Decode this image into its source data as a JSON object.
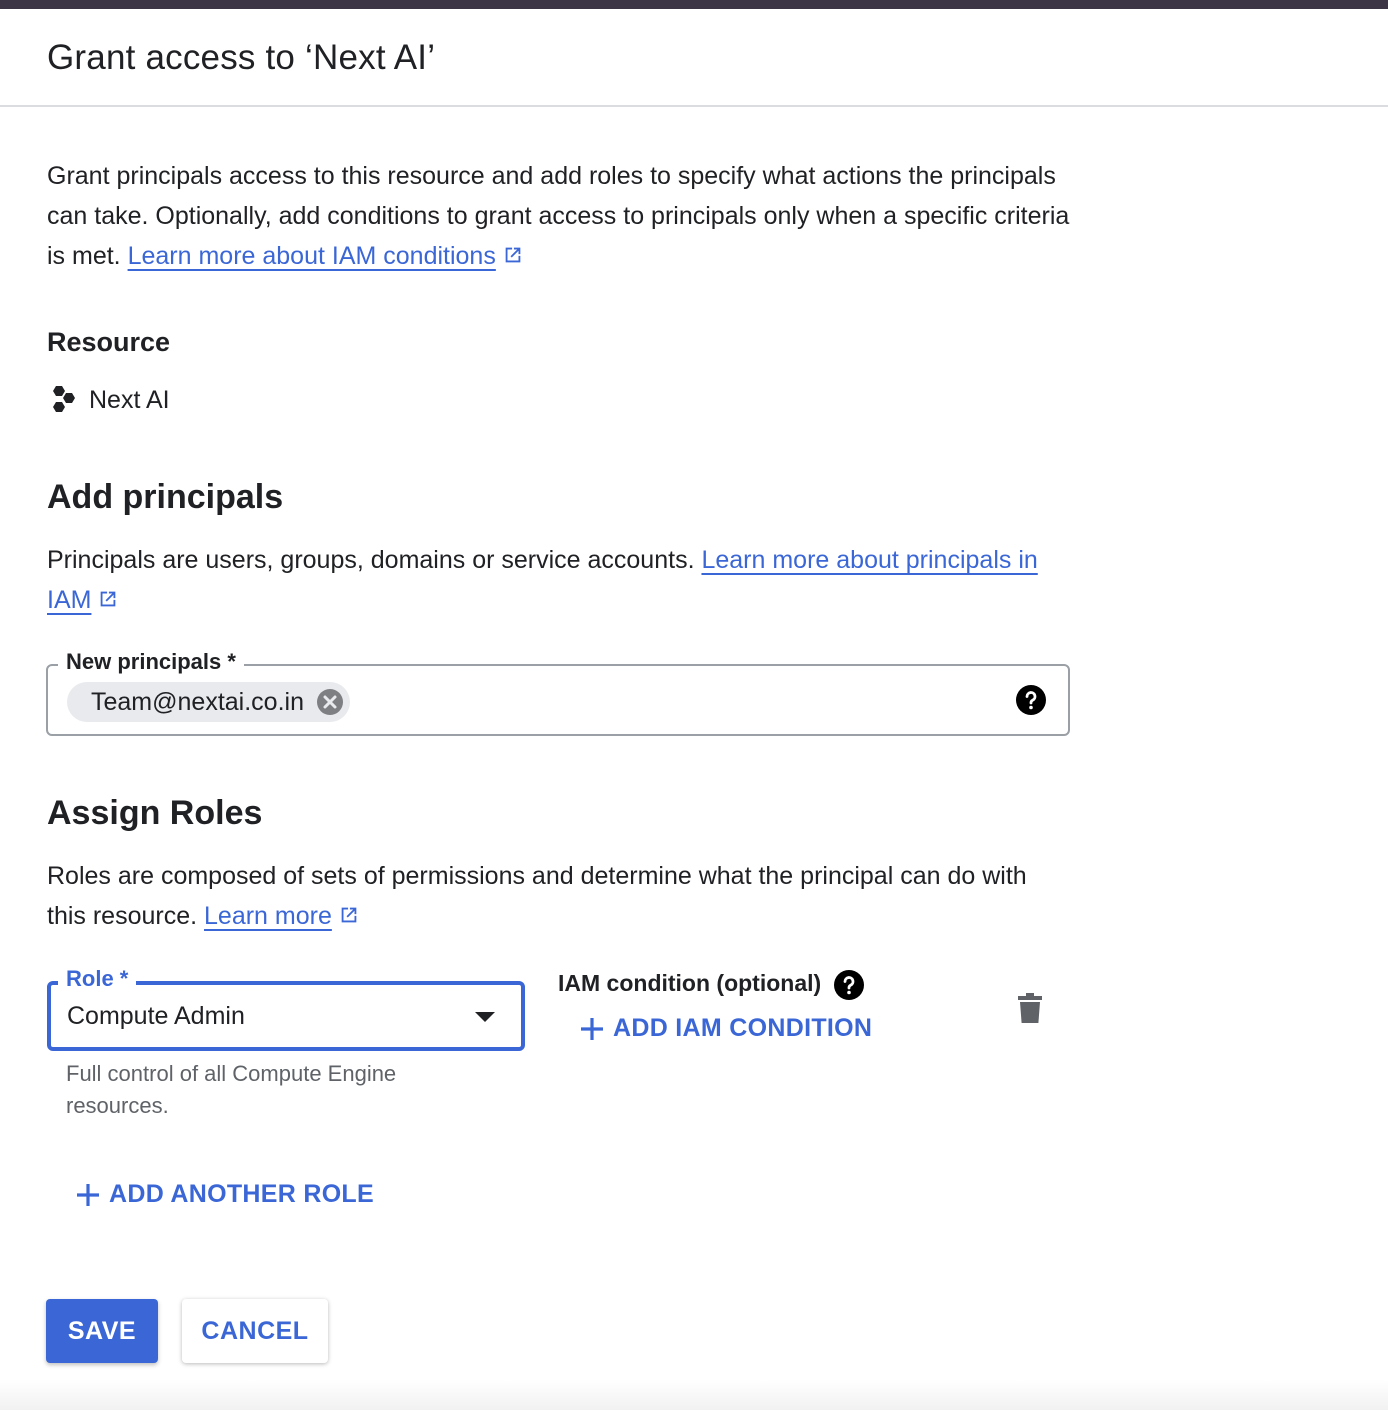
{
  "header": {
    "title": "Grant access to ‘Next AI’"
  },
  "intro": {
    "text": "Grant principals access to this resource and add roles to specify what actions the principals can take. Optionally, add conditions to grant access to principals only when a specific criteria is met.",
    "link": "Learn more about IAM conditions"
  },
  "resource": {
    "heading": "Resource",
    "name": "Next AI",
    "icon": "project-hexagons-icon"
  },
  "principals": {
    "heading": "Add principals",
    "text": "Principals are users, groups, domains or service accounts.",
    "link": "Learn more about principals in IAM",
    "field_label": "New principals *",
    "chips": [
      "Team@nextai.co.in"
    ]
  },
  "roles": {
    "heading": "Assign Roles",
    "text": "Roles are composed of sets of permissions and determine what the principal can do with this resource.",
    "link": "Learn more",
    "role_label": "Role *",
    "role_value": "Compute Admin",
    "role_description": "Full control of all Compute Engine resources.",
    "iam_condition_label": "IAM condition (optional)",
    "add_condition": "ADD IAM CONDITION",
    "add_role": "ADD ANOTHER ROLE"
  },
  "footer": {
    "save": "SAVE",
    "cancel": "CANCEL"
  },
  "colors": {
    "accent": "#3b67d6",
    "text": "#202124",
    "muted": "#5f6368",
    "chip": "#e8eaed"
  }
}
